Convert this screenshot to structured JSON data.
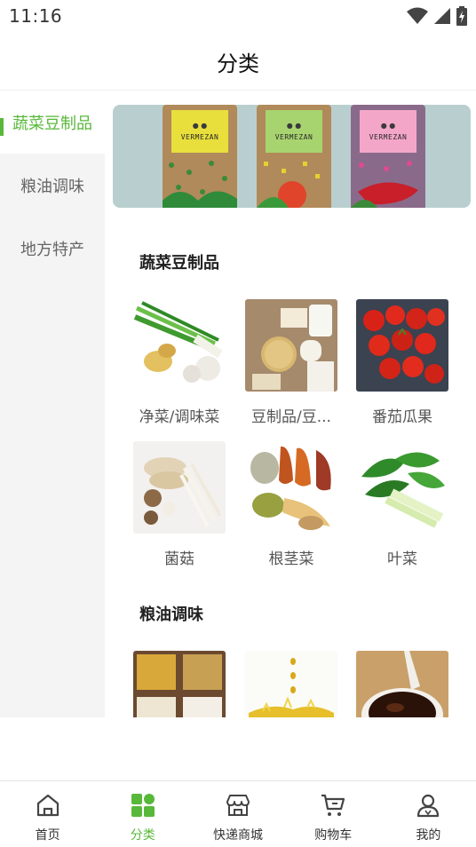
{
  "status_bar": {
    "time": "11:16"
  },
  "header": {
    "title": "分类"
  },
  "sidebar": {
    "items": [
      {
        "label": "蔬菜豆制品",
        "active": true
      },
      {
        "label": "粮油调味",
        "active": false
      },
      {
        "label": "地方特产",
        "active": false
      }
    ]
  },
  "banner": {
    "bags": [
      {
        "brand_text": "VERMEZAN",
        "label_color": "#e8df3c"
      },
      {
        "brand_text": "VERMEZAN",
        "label_color": "#a8d470"
      },
      {
        "brand_text": "VERMEZAN",
        "label_color": "#f4a6c8"
      }
    ]
  },
  "sections": [
    {
      "title": "蔬菜豆制品",
      "items": [
        {
          "label": "净菜/调味菜",
          "icon": "green-onion-ginger-garlic-image"
        },
        {
          "label": "豆制品/豆...",
          "icon": "tofu-soy-products-image"
        },
        {
          "label": "番茄瓜果",
          "icon": "tomatoes-image"
        },
        {
          "label": "菌菇",
          "icon": "mushrooms-image"
        },
        {
          "label": "根茎菜",
          "icon": "root-vegetables-image"
        },
        {
          "label": "叶菜",
          "icon": "leafy-greens-image"
        }
      ]
    },
    {
      "title": "粮油调味",
      "items": [
        {
          "label": "",
          "icon": "grains-image"
        },
        {
          "label": "",
          "icon": "cooking-oil-image"
        },
        {
          "label": "",
          "icon": "soy-sauce-image"
        }
      ]
    }
  ],
  "tabbar": {
    "tabs": [
      {
        "label": "首页",
        "icon": "home-icon",
        "active": false
      },
      {
        "label": "分类",
        "icon": "category-grid-icon",
        "active": true
      },
      {
        "label": "快递商城",
        "icon": "store-icon",
        "active": false
      },
      {
        "label": "购物车",
        "icon": "cart-icon",
        "active": false
      },
      {
        "label": "我的",
        "icon": "user-icon",
        "active": false
      }
    ]
  },
  "colors": {
    "accent": "#58b83a",
    "sidebar_bg": "#f4f4f4",
    "text": "#333333"
  }
}
